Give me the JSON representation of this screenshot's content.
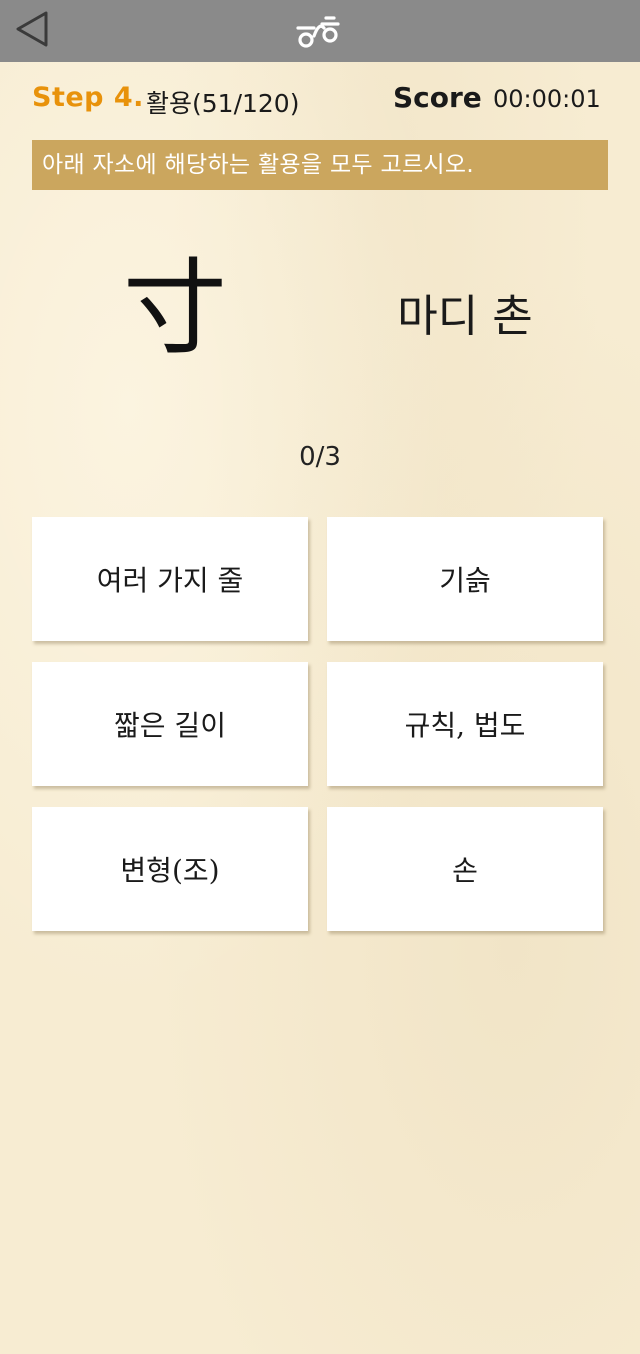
{
  "header": {
    "back_icon": "back-arrow-icon",
    "logo_icon": "app-logo-icon",
    "bar_color": "#8a8a8a"
  },
  "step": {
    "label": "Step 4.",
    "title": "활용(51/120)",
    "label_color": "#e8920b"
  },
  "score": {
    "label": "Score",
    "time": "00:00:01"
  },
  "instruction": {
    "text": "아래 자소에 해당하는 활용을 모두 고르시오.",
    "bg_color": "#cba65e"
  },
  "question": {
    "character": "寸",
    "meaning": "마디 촌"
  },
  "progress": {
    "text": "0/3"
  },
  "options": [
    {
      "label": "여러 가지 줄"
    },
    {
      "label": "기슭"
    },
    {
      "label": "짧은 길이"
    },
    {
      "label": "규칙, 법도"
    },
    {
      "label": "변형(조)"
    },
    {
      "label": "손"
    }
  ]
}
